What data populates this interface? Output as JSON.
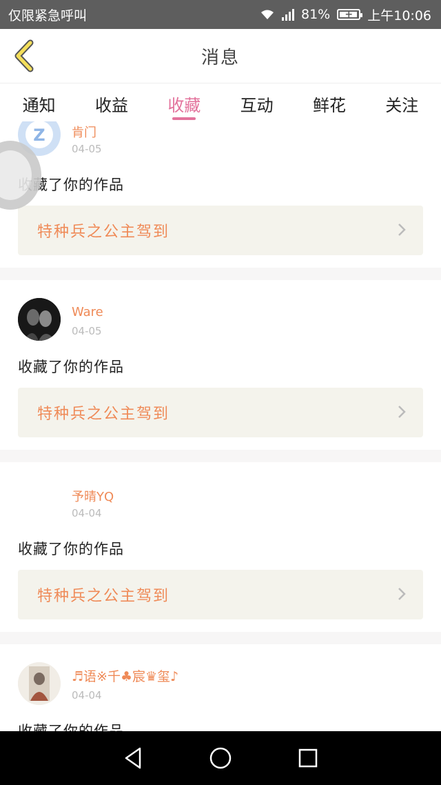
{
  "status_bar": {
    "carrier": "仅限紧急呼叫",
    "battery_level": "81%",
    "time": "上午10:06"
  },
  "header": {
    "title": "消息"
  },
  "tabs": [
    {
      "label": "通知"
    },
    {
      "label": "收益"
    },
    {
      "label": "收藏",
      "active": true
    },
    {
      "label": "互动"
    },
    {
      "label": "鲜花"
    },
    {
      "label": "关注"
    }
  ],
  "items": [
    {
      "user": "肯门",
      "date": "04-05",
      "action": "收藏了你的作品",
      "work_title": "特种兵之公主驾到"
    },
    {
      "user": "Ware",
      "date": "04-05",
      "action": "收藏了你的作品",
      "work_title": "特种兵之公主驾到"
    },
    {
      "user": "予晴YQ",
      "date": "04-04",
      "action": "收藏了你的作品",
      "work_title": "特种兵之公主驾到"
    },
    {
      "user": "♬语※千♣宸♛玺♪",
      "date": "04-04",
      "action": "收藏了你的作品"
    }
  ],
  "colors": {
    "accent": "#e3739c",
    "username": "#ef8a57",
    "work_bg": "#f4f3ec"
  }
}
